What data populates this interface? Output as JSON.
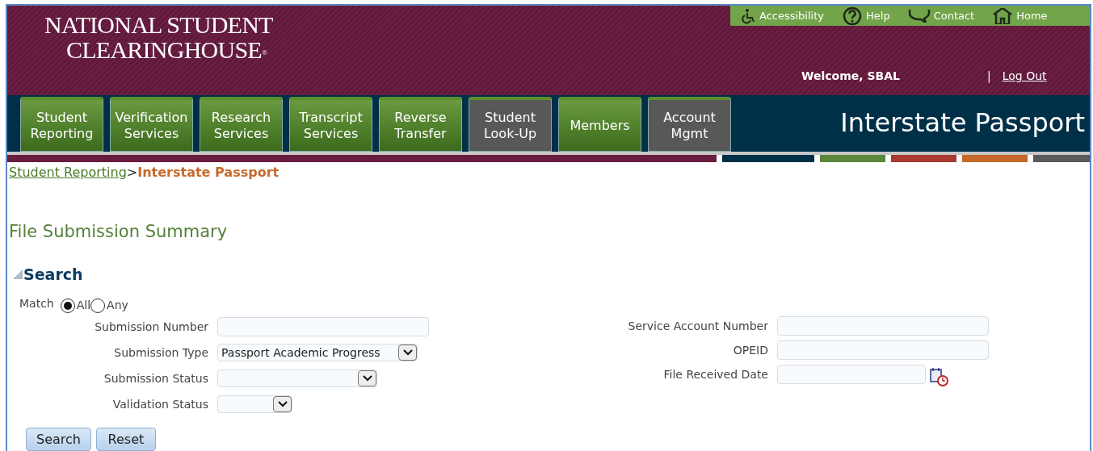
{
  "logo": {
    "line_1": "NATIONAL STUDENT",
    "line_2": "CLEARINGHOUSE",
    "mark": "®"
  },
  "utility_links": [
    {
      "label": "Accessibility",
      "kind": "accessibility"
    },
    {
      "label": "Help",
      "kind": "help"
    },
    {
      "label": "Contact",
      "kind": "contact"
    },
    {
      "label": "Home",
      "kind": "home"
    }
  ],
  "welcome": "Welcome, SBAL",
  "separator": "|",
  "logout": "Log Out",
  "nav_tabs": [
    {
      "label": "Student Reporting",
      "dimmed": false
    },
    {
      "label": "Verification Services",
      "dimmed": false
    },
    {
      "label": "Research Services",
      "dimmed": false
    },
    {
      "label": "Transcript Services",
      "dimmed": false
    },
    {
      "label": "Reverse Transfer",
      "dimmed": false
    },
    {
      "label": "Student Look-Up",
      "dimmed": true
    },
    {
      "label": "Members",
      "dimmed": false
    },
    {
      "label": "Account Mgmt",
      "dimmed": true
    }
  ],
  "app_title": "Interstate Passport",
  "breadcrumb": {
    "link": "Student Reporting",
    "separator": ">",
    "current": "Interstate Passport"
  },
  "page_title": "File Submission Summary",
  "search": {
    "title": "Search",
    "expanded": true,
    "match_label": "Match",
    "match_options": [
      {
        "label": "All",
        "selected": true
      },
      {
        "label": "Any",
        "selected": false
      }
    ],
    "left_fields": [
      {
        "label": "Submission Number",
        "kind": "text"
      },
      {
        "label": "Submission Type",
        "kind": "select",
        "value": "Passport Academic Progress"
      },
      {
        "label": "Submission Status",
        "kind": "select"
      },
      {
        "label": "Validation Status",
        "kind": "select"
      }
    ],
    "right_fields": [
      {
        "label": "Service Account Number",
        "kind": "text"
      },
      {
        "label": "OPEID",
        "kind": "text"
      },
      {
        "label": "File Received Date",
        "kind": "date"
      }
    ],
    "buttons": [
      "Search",
      "Reset"
    ]
  }
}
